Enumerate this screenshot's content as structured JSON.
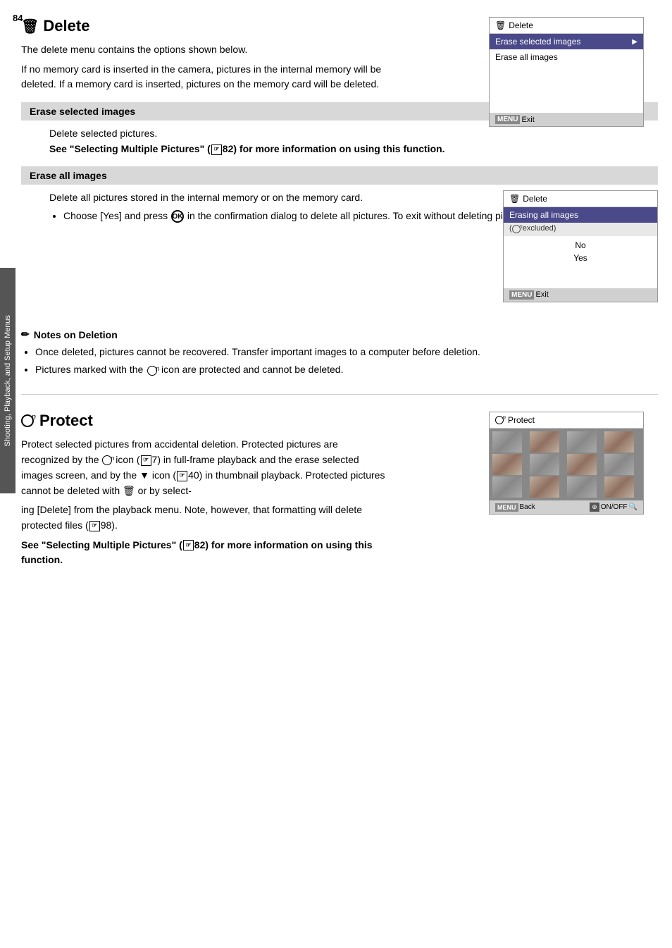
{
  "page": {
    "number": "84"
  },
  "side_tab": {
    "text": "Shooting, Playback, and Setup Menus"
  },
  "delete_section": {
    "title": "Delete",
    "intro_1": "The delete menu contains the options shown below.",
    "intro_2": "If no memory card is inserted in the camera, pictures in the internal memory will be deleted. If a memory card is inserted, pictures on the memory card will be deleted.",
    "camera_menu_1": {
      "title": "Delete",
      "item1": "Erase selected images",
      "item2": "Erase all images",
      "footer": "Exit"
    },
    "erase_selected": {
      "header": "Erase selected images",
      "line1": "Delete selected pictures.",
      "line2": "See \"Selecting Multiple Pictures\" (",
      "ref_num": "82",
      "line2_end": ") for more information on using this function."
    },
    "erase_all": {
      "header": "Erase all images",
      "line1": "Delete all pictures stored in the internal memory or on the memory card.",
      "bullet1_start": "Choose [Yes] and press ",
      "bullet1_mid": " in the confirmation dialog to delete all pictures. To exit without deleting pictures, choose [No] and press ",
      "bullet1_end": ".",
      "camera_menu_2": {
        "title": "Delete",
        "highlight": "Erasing all images",
        "sub": "( excluded)",
        "option1": "No",
        "option2": "Yes",
        "footer": "Exit"
      }
    },
    "notes": {
      "title": "Notes on Deletion",
      "bullet1": "Once deleted, pictures cannot be recovered. Transfer important images to a computer before deletion.",
      "bullet2": "Pictures marked with the  icon are protected and cannot be deleted."
    }
  },
  "protect_section": {
    "title": "Protect",
    "text1_start": "Protect selected pictures from accidental deletion. Protected pictures are recognized by the ",
    "text1_icon": "On",
    "text1_mid": " icon (",
    "text1_ref": "7",
    "text1_cont": ") in full-frame playback and the erase selected images screen, and by the ",
    "text1_icon2": "T",
    "text1_ref2": "40",
    "text1_end": ") in thumbnail playback. Protected pictures cannot be deleted with  or by select-",
    "text2": "ing [Delete] from the playback menu. Note, however, that formatting will delete protected files (",
    "text2_ref": "98",
    "text2_end": ").",
    "bold_line": "See \"Selecting Multiple Pictures\" (",
    "bold_ref": "82",
    "bold_end": ") for more information on using this function.",
    "camera_menu_3": {
      "title": "Protect",
      "footer_back": "Back",
      "footer_onoff": "ON/OFF",
      "footer_search": "🔍"
    }
  }
}
